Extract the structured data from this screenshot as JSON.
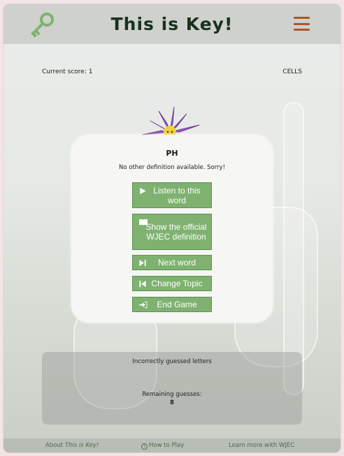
{
  "header": {
    "title": "This is Key!",
    "logo_icon": "key-icon",
    "menu_icon": "hamburger-menu-icon",
    "accent_color": "#b0552b",
    "logo_color": "#7fb270"
  },
  "score": {
    "label": "Current score: 1",
    "topic": "CELLS"
  },
  "modal": {
    "word": "PH",
    "definition": "No other definition available. Sorry!",
    "buttons": {
      "listen": "Listen to this word",
      "definition": "Show the official WJEC definition",
      "next": "Next word",
      "change_topic": "Change Topic",
      "end": "End Game"
    },
    "button_color": "#7fb270"
  },
  "guesses": {
    "incorrect_label": "Incorrectly guessed letters",
    "remaining_label": "Remaining guesses:",
    "remaining_count": "8"
  },
  "footer": {
    "about_prefix": "About ",
    "about_name": "This is Key!",
    "how_to_play": "How to Play",
    "learn_more": "Learn more with WJEC"
  }
}
